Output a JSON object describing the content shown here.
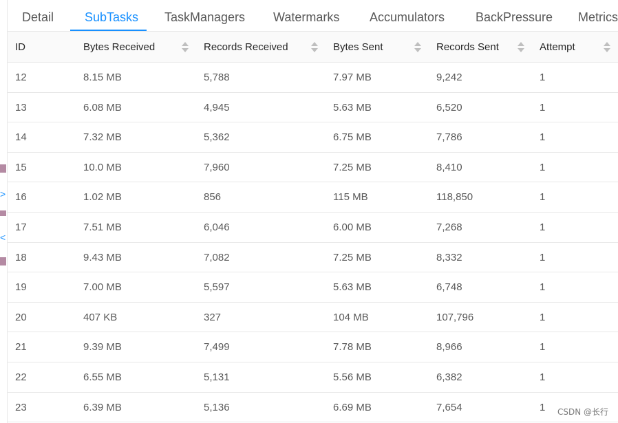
{
  "tabs": [
    {
      "label": "Detail",
      "active": false
    },
    {
      "label": "SubTasks",
      "active": true
    },
    {
      "label": "TaskManagers",
      "active": false
    },
    {
      "label": "Watermarks",
      "active": false
    },
    {
      "label": "Accumulators",
      "active": false
    },
    {
      "label": "BackPressure",
      "active": false
    },
    {
      "label": "Metrics",
      "active": false
    }
  ],
  "table": {
    "columns": [
      "ID",
      "Bytes Received",
      "Records Received",
      "Bytes Sent",
      "Records Sent",
      "Attempt"
    ],
    "rows": [
      [
        "12",
        "8.15 MB",
        "5,788",
        "7.97 MB",
        "9,242",
        "1"
      ],
      [
        "13",
        "6.08 MB",
        "4,945",
        "5.63 MB",
        "6,520",
        "1"
      ],
      [
        "14",
        "7.32 MB",
        "5,362",
        "6.75 MB",
        "7,786",
        "1"
      ],
      [
        "15",
        "10.0 MB",
        "7,960",
        "7.25 MB",
        "8,410",
        "1"
      ],
      [
        "16",
        "1.02 MB",
        "856",
        "115 MB",
        "118,850",
        "1"
      ],
      [
        "17",
        "7.51 MB",
        "6,046",
        "6.00 MB",
        "7,268",
        "1"
      ],
      [
        "18",
        "9.43 MB",
        "7,082",
        "7.25 MB",
        "8,332",
        "1"
      ],
      [
        "19",
        "7.00 MB",
        "5,597",
        "5.63 MB",
        "6,748",
        "1"
      ],
      [
        "20",
        "407 KB",
        "327",
        "104 MB",
        "107,796",
        "1"
      ],
      [
        "21",
        "9.39 MB",
        "7,499",
        "7.78 MB",
        "8,966",
        "1"
      ],
      [
        "22",
        "6.55 MB",
        "5,131",
        "5.56 MB",
        "6,382",
        "1"
      ],
      [
        "23",
        "6.39 MB",
        "5,136",
        "6.69 MB",
        "7,654",
        "1"
      ]
    ]
  },
  "side": {
    "expand_glyph": ">",
    "collapse_glyph": "<"
  },
  "watermark": "CSDN @长行",
  "colors": {
    "accent": "#1890ff",
    "text": "#595959",
    "header_text": "#262626",
    "border": "#e8e8e8",
    "header_bg": "#fafafa",
    "edge_mark": "#b48aa3"
  }
}
